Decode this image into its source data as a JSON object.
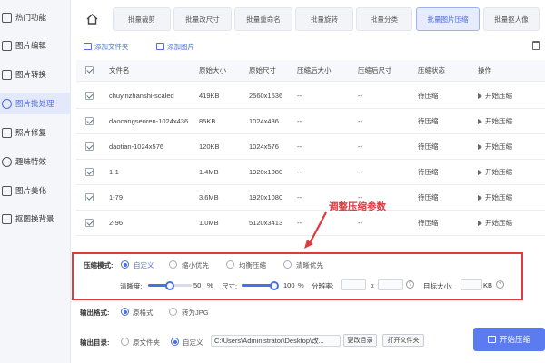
{
  "sidebar": {
    "items": [
      {
        "label": "热门功能"
      },
      {
        "label": "图片编辑"
      },
      {
        "label": "图片转换"
      },
      {
        "label": "图片批处理"
      },
      {
        "label": "照片修复"
      },
      {
        "label": "趣味特效"
      },
      {
        "label": "图片美化"
      },
      {
        "label": "抠图换背景"
      }
    ],
    "active_index": 3
  },
  "tabs": [
    {
      "label": "批量裁剪"
    },
    {
      "label": "批量改尺寸"
    },
    {
      "label": "批量重命名"
    },
    {
      "label": "批量旋转"
    },
    {
      "label": "批量分类"
    },
    {
      "label": "批量图片压缩"
    },
    {
      "label": "批量抠人像"
    }
  ],
  "toolbar": {
    "add_folder": "添加文件夹",
    "add_image": "添加图片"
  },
  "table": {
    "columns": [
      "文件名",
      "原始大小",
      "原始尺寸",
      "压缩后大小",
      "压缩后尺寸",
      "压缩状态",
      "操作"
    ],
    "rows": [
      {
        "name": "chuyinzhanshi-scaled",
        "size": "419KB",
        "dims": "2560x1536",
        "csize": "--",
        "cdims": "--",
        "status": "待压缩",
        "action": "开始压缩"
      },
      {
        "name": "daocangsenren-1024x436",
        "size": "85KB",
        "dims": "1024x436",
        "csize": "--",
        "cdims": "--",
        "status": "待压缩",
        "action": "开始压缩"
      },
      {
        "name": "daotian-1024x576",
        "size": "120KB",
        "dims": "1024x576",
        "csize": "--",
        "cdims": "--",
        "status": "待压缩",
        "action": "开始压缩"
      },
      {
        "name": "1-1",
        "size": "1.4MB",
        "dims": "1920x1080",
        "csize": "--",
        "cdims": "--",
        "status": "待压缩",
        "action": "开始压缩"
      },
      {
        "name": "1-79",
        "size": "3.6MB",
        "dims": "1920x1080",
        "csize": "--",
        "cdims": "--",
        "status": "待压缩",
        "action": "开始压缩"
      },
      {
        "name": "2-96",
        "size": "1.0MB",
        "dims": "5120x3413",
        "csize": "--",
        "cdims": "--",
        "status": "待压缩",
        "action": "开始压缩"
      }
    ]
  },
  "annotation": {
    "text": "调整压缩参数",
    "color": "#e0393e"
  },
  "compression": {
    "mode_label": "压缩模式:",
    "modes": [
      "自定义",
      "缩小优先",
      "均衡压缩",
      "清晰优先"
    ],
    "selected_mode": 0,
    "clarity_label": "清晰度:",
    "clarity_value": "50",
    "clarity_unit": "%",
    "clarity_fraction": 0.5,
    "size_label": "尺寸:",
    "size_value": "100",
    "size_unit": "%",
    "size_fraction": 1.0,
    "resolution_label": "分辨率:",
    "resolution_x_sep": "x",
    "target_label": "目标大小:",
    "target_unit": "KB"
  },
  "output_format": {
    "label": "输出格式:",
    "options": [
      "原格式",
      "转为JPG"
    ],
    "selected": 0
  },
  "output_dir": {
    "label": "输出目录:",
    "options": [
      "原文件夹",
      "自定义"
    ],
    "selected": 1,
    "path": "C:\\Users\\Administrator\\Desktop\\改...",
    "change_btn": "更改目录",
    "open_btn": "打开文件夹"
  },
  "start_button": "开始压缩",
  "colors": {
    "accent": "#4a6fe3",
    "annotation": "#e0393e",
    "button": "#5b7cf0"
  }
}
